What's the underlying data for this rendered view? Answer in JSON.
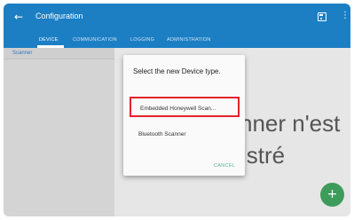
{
  "toolbar": {
    "back_icon": "arrow-left-icon",
    "title": "Configuration",
    "save_icon": "save-icon",
    "menu_icon": "more-vertical-icon"
  },
  "tabs": [
    {
      "label": "DEVICE",
      "active": true
    },
    {
      "label": "COMMUNICATION",
      "active": false
    },
    {
      "label": "LOGGING",
      "active": false
    },
    {
      "label": "ADMINISTRATION",
      "active": false
    }
  ],
  "sidebar": {
    "items": [
      {
        "label": "Scanner",
        "selected": true
      }
    ]
  },
  "background_message": {
    "line1": "nner n'est",
    "line2": "istré"
  },
  "dialog": {
    "title": "Select the new Device type.",
    "options": [
      {
        "label": "Embedded Honeywell Scan...",
        "highlighted": true
      },
      {
        "label": "Bluetooth Scanner",
        "highlighted": false
      }
    ],
    "cancel_label": "CANCEL"
  },
  "fab": {
    "icon": "plus-icon",
    "label": "+"
  },
  "colors": {
    "toolbar": "#1c7fc4",
    "fab": "#3d9c5a",
    "highlight_border": "#e2242b",
    "cancel": "#55b78f"
  }
}
